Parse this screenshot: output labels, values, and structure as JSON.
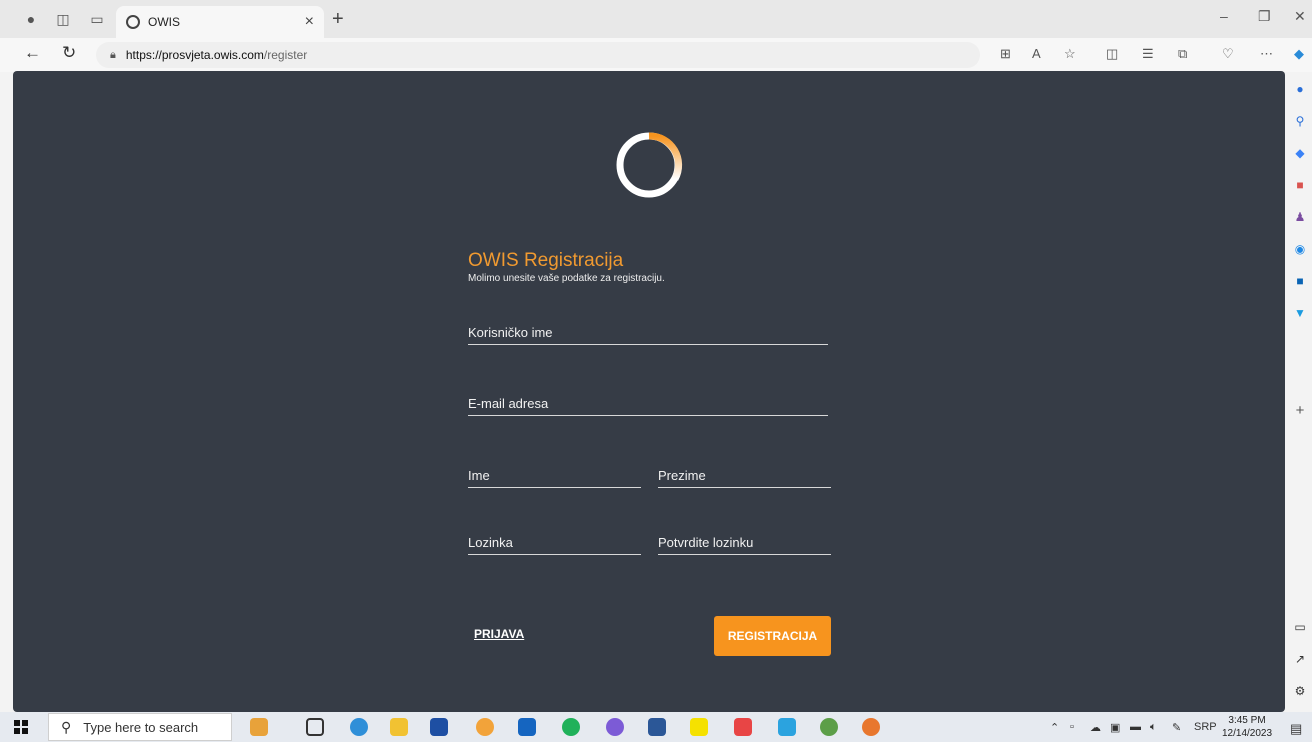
{
  "tab": {
    "title": "OWIS",
    "close": "×",
    "new": "+"
  },
  "window": {
    "minimize": "–",
    "restore": "❐",
    "close": "✕"
  },
  "address": {
    "host": "https://prosvjeta.owis.com",
    "path": "/register"
  },
  "form": {
    "title": "OWIS Registracija",
    "subtitle": "Molimo unesite vaše podatke za registraciju.",
    "username_placeholder": "Korisničko ime",
    "email_placeholder": "E-mail adresa",
    "first_name_placeholder": "Ime",
    "last_name_placeholder": "Prezime",
    "password_placeholder": "Lozinka",
    "confirm_password_placeholder": "Potvrdite lozinku",
    "login_link": "PRIJAVA",
    "register_button": "REGISTRACIJA"
  },
  "taskbar": {
    "search_placeholder": "Type here to search",
    "language": "SRP",
    "time": "3:45 PM",
    "date": "12/14/2023"
  },
  "colors": {
    "accent": "#f7941e",
    "page_bg": "#363c46"
  },
  "icons": [
    "profile-icon",
    "workspaces-icon",
    "tab-actions-icon",
    "back-icon",
    "refresh-icon",
    "lock-icon",
    "reader-icon",
    "read-aloud-icon",
    "favorite-icon",
    "split-icon",
    "favorites-list-icon",
    "collections-icon",
    "performance-icon",
    "more-icon",
    "copilot-icon"
  ]
}
